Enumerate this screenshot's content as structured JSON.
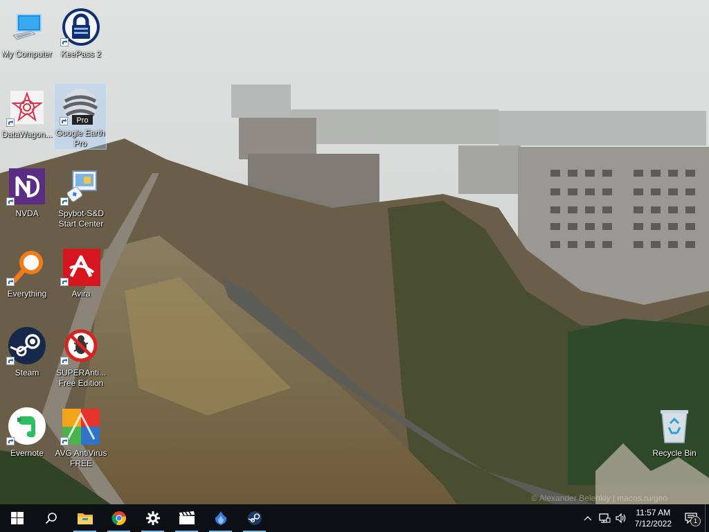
{
  "desktop": {
    "icons": [
      {
        "label": "My Computer",
        "icon": "computer-icon"
      },
      {
        "label": "KeePass 2",
        "icon": "keepass-lock-icon"
      },
      {
        "label": "DataWagon...",
        "icon": "datawagon-icon"
      },
      {
        "label": "Google Earth Pro",
        "icon": "google-earth-icon",
        "badge": "Pro"
      },
      {
        "label": "NVDA",
        "icon": "nvda-icon"
      },
      {
        "label": "Spybot-S&D Start Center",
        "icon": "spybot-icon"
      },
      {
        "label": "Everything",
        "icon": "everything-search-icon"
      },
      {
        "label": "Avira",
        "icon": "avira-icon"
      },
      {
        "label": "Steam",
        "icon": "steam-icon"
      },
      {
        "label": "SUPERAnti... Free Edition",
        "icon": "superantispyware-icon"
      },
      {
        "label": "Evernote",
        "icon": "evernote-icon"
      },
      {
        "label": "AVG AntiVirus FREE",
        "icon": "avg-icon"
      },
      {
        "label": "Recycle Bin",
        "icon": "recycle-bin-icon"
      }
    ]
  },
  "wallpaper": {
    "credit": "© Alexander Belenkiy | macos.ru/geo"
  },
  "taskbar": {
    "pinned": [
      {
        "name": "file-explorer",
        "icon": "folder-icon"
      },
      {
        "name": "google-chrome",
        "icon": "chrome-icon"
      },
      {
        "name": "settings",
        "icon": "gear-icon"
      },
      {
        "name": "video-editor",
        "icon": "clapperboard-icon"
      },
      {
        "name": "app",
        "icon": "blue-flame-icon"
      },
      {
        "name": "steam",
        "icon": "steam-icon"
      }
    ],
    "clock": {
      "time": "11:57 AM",
      "date": "7/12/2022"
    },
    "notifications_count": "1"
  },
  "colors": {
    "taskbar_bg": "#0c0f14",
    "accent": "#76b9ed"
  }
}
